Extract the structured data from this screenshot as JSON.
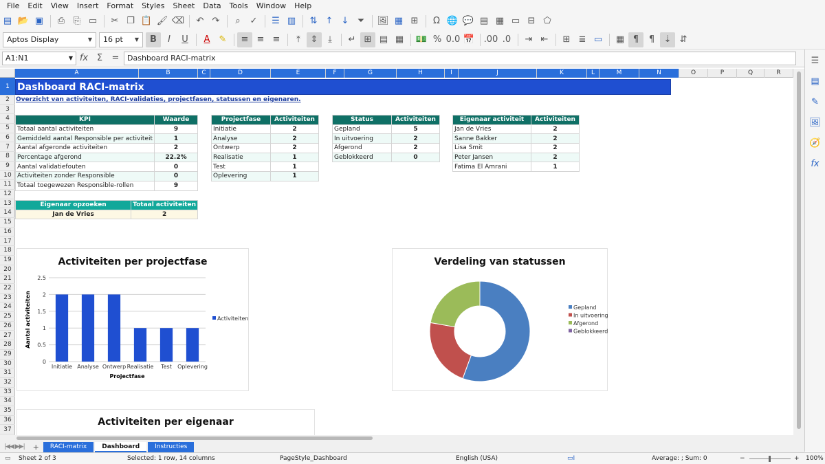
{
  "menu": [
    "File",
    "Edit",
    "View",
    "Insert",
    "Format",
    "Styles",
    "Sheet",
    "Data",
    "Tools",
    "Window",
    "Help"
  ],
  "toolbar": {
    "font": "Aptos Display",
    "size": "16 pt"
  },
  "formula": {
    "namebox": "A1:N1",
    "content": "Dashboard RACI-matrix"
  },
  "columns": [
    "A",
    "B",
    "C",
    "D",
    "E",
    "F",
    "G",
    "H",
    "I",
    "J",
    "K",
    "L",
    "M",
    "N",
    "O",
    "P",
    "Q",
    "R"
  ],
  "rows": [
    "1",
    "2",
    "3",
    "4",
    "5",
    "6",
    "7",
    "8",
    "9",
    "10",
    "11",
    "12",
    "13",
    "14",
    "15",
    "16",
    "17",
    "18",
    "19",
    "20",
    "21",
    "22",
    "23",
    "24",
    "25",
    "26",
    "27",
    "28",
    "29",
    "30",
    "31",
    "32",
    "33",
    "34",
    "35",
    "36",
    "37"
  ],
  "sheet": {
    "title": "Dashboard RACI-matrix",
    "subtitle": "Overzicht van activiteiten, RACI-validaties, projectfasen, statussen en eigenaren."
  },
  "kpi": {
    "headers": [
      "KPI",
      "Waarde"
    ],
    "rows": [
      [
        "Totaal aantal activiteiten",
        "9"
      ],
      [
        "Gemiddeld aantal Responsible per activiteit",
        "1"
      ],
      [
        "Aantal afgeronde activiteiten",
        "2"
      ],
      [
        "Percentage afgerond",
        "22.2%"
      ],
      [
        "Aantal validatiefouten",
        "0"
      ],
      [
        "Activiteiten zonder Responsible",
        "0"
      ],
      [
        "Totaal toegewezen Responsible-rollen",
        "9"
      ]
    ]
  },
  "fase": {
    "headers": [
      "Projectfase",
      "Activiteiten"
    ],
    "rows": [
      [
        "Initiatie",
        "2"
      ],
      [
        "Analyse",
        "2"
      ],
      [
        "Ontwerp",
        "2"
      ],
      [
        "Realisatie",
        "1"
      ],
      [
        "Test",
        "1"
      ],
      [
        "Oplevering",
        "1"
      ]
    ]
  },
  "status": {
    "headers": [
      "Status",
      "Activiteiten"
    ],
    "rows": [
      [
        "Gepland",
        "5"
      ],
      [
        "In uitvoering",
        "2"
      ],
      [
        "Afgerond",
        "2"
      ],
      [
        "Geblokkeerd",
        "0"
      ]
    ]
  },
  "eigenaar": {
    "headers": [
      "Eigenaar activiteit",
      "Activiteiten"
    ],
    "rows": [
      [
        "Jan de Vries",
        "2"
      ],
      [
        "Sanne Bakker",
        "2"
      ],
      [
        "Lisa Smit",
        "2"
      ],
      [
        "Peter Jansen",
        "2"
      ],
      [
        "Fatima El Amrani",
        "1"
      ]
    ]
  },
  "lookup": {
    "headers": [
      "Eigenaar opzoeken",
      "Totaal activiteiten"
    ],
    "name": "Jan de Vries",
    "value": "2"
  },
  "chart_data": [
    {
      "type": "bar",
      "title": "Activiteiten per projectfase",
      "xlabel": "Projectfase",
      "ylabel": "Aantal activiteiten",
      "categories": [
        "Initiatie",
        "Analyse",
        "Ontwerp",
        "Realisatie",
        "Test",
        "Oplevering"
      ],
      "series": [
        {
          "name": "Activiteiten",
          "values": [
            2,
            2,
            2,
            1,
            1,
            1
          ]
        }
      ],
      "ylim": [
        0,
        2.5
      ],
      "yticks": [
        "0",
        "0.5",
        "1",
        "1.5",
        "2",
        "2.5"
      ],
      "legend": "right",
      "color": "#1f4fd1"
    },
    {
      "type": "pie",
      "title": "Verdeling van statussen",
      "labels": [
        "Gepland",
        "In uitvoering",
        "Afgerond",
        "Geblokkeerd"
      ],
      "values": [
        5,
        2,
        2,
        0
      ],
      "colors": [
        "#4a7fc1",
        "#c0504d",
        "#9bbb59",
        "#8064a2"
      ],
      "legend": "right"
    },
    {
      "type": "bar",
      "title": "Activiteiten per eigenaar"
    }
  ],
  "tabs": [
    "RACI-matrix",
    "Dashboard",
    "Instructies"
  ],
  "statusbar": {
    "sheet": "Sheet 2 of 3",
    "selection": "Selected: 1 row, 14 columns",
    "pagestyle": "PageStyle_Dashboard",
    "lang": "English (USA)",
    "sum": "Average: ; Sum: 0",
    "zoom": "100%"
  }
}
